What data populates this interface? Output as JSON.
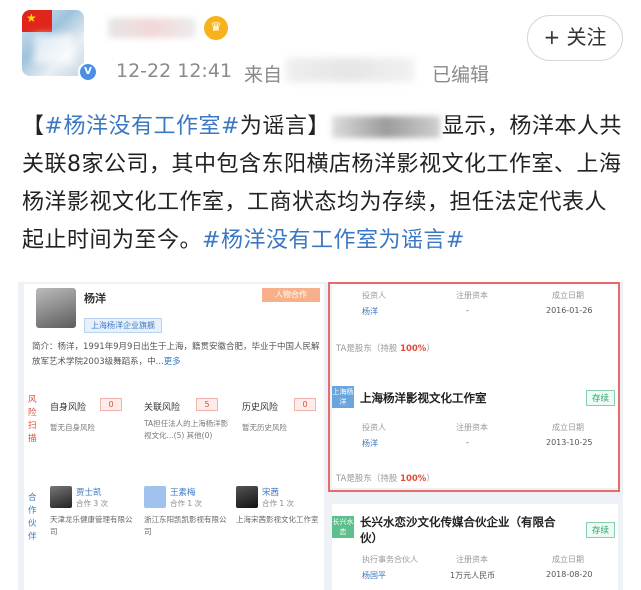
{
  "header": {
    "timestamp": "12-22 12:41",
    "source_prefix": "来自",
    "edited": "已编辑",
    "follow_button": "+ 关注",
    "flag_star": "★",
    "verified_mark": "V",
    "crown_glyph": "♛"
  },
  "post": {
    "bracket_open": "【",
    "hashtag_title": "#杨洋没有工作室#",
    "title_suffix": "为谣言",
    "bracket_close": "】",
    "body": "显示，杨洋本人共关联8家公司，其中包含东阳横店杨洋影视文化工作室、上海杨洋影视文化工作室，工商状态均为存续，担任法定代表人起止时间为至今。",
    "hashtag_end": "#杨洋没有工作室为谣言#"
  },
  "screenshot": {
    "left_panel": {
      "name": "杨洋",
      "tag": "上海杨洋企业旗舰",
      "top_badge": "人物合作",
      "intro": "简介：杨洋，1991年9月9日出生于上海，籍贯安徽合肥，毕业于中国人民解放军艺术学院2003级舞蹈系，中...",
      "intro_more": "更多",
      "risk_side_label": "风险扫描",
      "risk_items": [
        {
          "label": "自身风险",
          "count": "0",
          "sub": "暂无自身风险"
        },
        {
          "label": "关联风险",
          "count": "5",
          "sub": "TA担任法人的上海杨洋影视文化...(5) 其他(0)"
        },
        {
          "label": "历史风险",
          "count": "0",
          "sub": "暂无历史风险"
        }
      ],
      "partner_side_label": "合作伙伴",
      "partners": [
        {
          "name": "贾士凯",
          "meta": "合作 3 次",
          "company": "天津龙乐健康管理有限公司"
        },
        {
          "name": "王素梅",
          "meta": "合作 1 次",
          "company": "浙江东阳凯凯影视有限公司"
        },
        {
          "name": "宋茜",
          "meta": "合作 1 次",
          "company": "上海宋茜影视文化工作室"
        }
      ]
    },
    "right_panel": {
      "companies": [
        {
          "headers": [
            "投资人",
            "注册资本",
            "成立日期"
          ],
          "investor": "杨洋",
          "capital": "-",
          "date": "2016-01-26",
          "share_prefix": "TA是股东（持股 ",
          "share_pct": "100%",
          "share_suffix": "）"
        },
        {
          "logo": "上海杨洋",
          "title": "上海杨洋影视文化工作室",
          "status": "存续",
          "headers": [
            "投资人",
            "注册资本",
            "成立日期"
          ],
          "investor": "杨洋",
          "capital": "-",
          "date": "2013-10-25",
          "share_prefix": "TA是股东（持股 ",
          "share_pct": "100%",
          "share_suffix": "）"
        },
        {
          "logo": "长兴水恋",
          "title": "长兴水恋沙文化传媒合伙企业（有限合伙）",
          "status": "存续",
          "headers": [
            "执行事务合伙人",
            "注册资本",
            "成立日期"
          ],
          "investor": "杨国平",
          "capital": "1万元人民币",
          "date": "2018-08-20"
        }
      ]
    }
  },
  "colors": {
    "hashtag": "#3a78c3",
    "risk_red": "#e04b3a",
    "status_green": "#2f9e6e",
    "frame_red": "#e76b6b"
  }
}
